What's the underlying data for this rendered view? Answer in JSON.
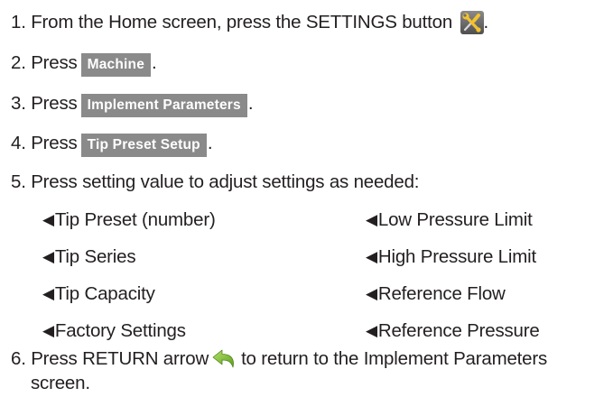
{
  "steps": {
    "s1_text": "1. From the Home screen, press the SETTINGS button",
    "s1_end": ".",
    "s2_text": "2. Press",
    "s2_button": "Machine",
    "s2_end": ".",
    "s3_text": "3. Press",
    "s3_button": "Implement Parameters",
    "s3_end": ".",
    "s4_text": "4. Press",
    "s4_button": "Tip Preset Setup",
    "s4_end": ".",
    "s5_text": "5. Press setting value to adjust settings as needed:",
    "s6_before": "6. Press RETURN arrow",
    "s6_after": "to return to the Implement Parameters",
    "s6_line2": "screen."
  },
  "settings_left": [
    "Tip Preset (number)",
    "Tip Series",
    "Tip Capacity",
    "Factory Settings"
  ],
  "settings_right": [
    "Low Pressure Limit",
    "High Pressure Limit",
    "Reference Flow",
    "Reference Pressure"
  ],
  "bullet_glyph": "◀",
  "icons": {
    "settings": "settings-tools-icon",
    "return": "return-arrow-icon"
  },
  "colors": {
    "text": "#231f20",
    "button_bg": "#8a8a8a",
    "button_text": "#ffffff",
    "settings_icon_bg": "#6e6e6e",
    "return_arrow": "#8cc63f"
  }
}
